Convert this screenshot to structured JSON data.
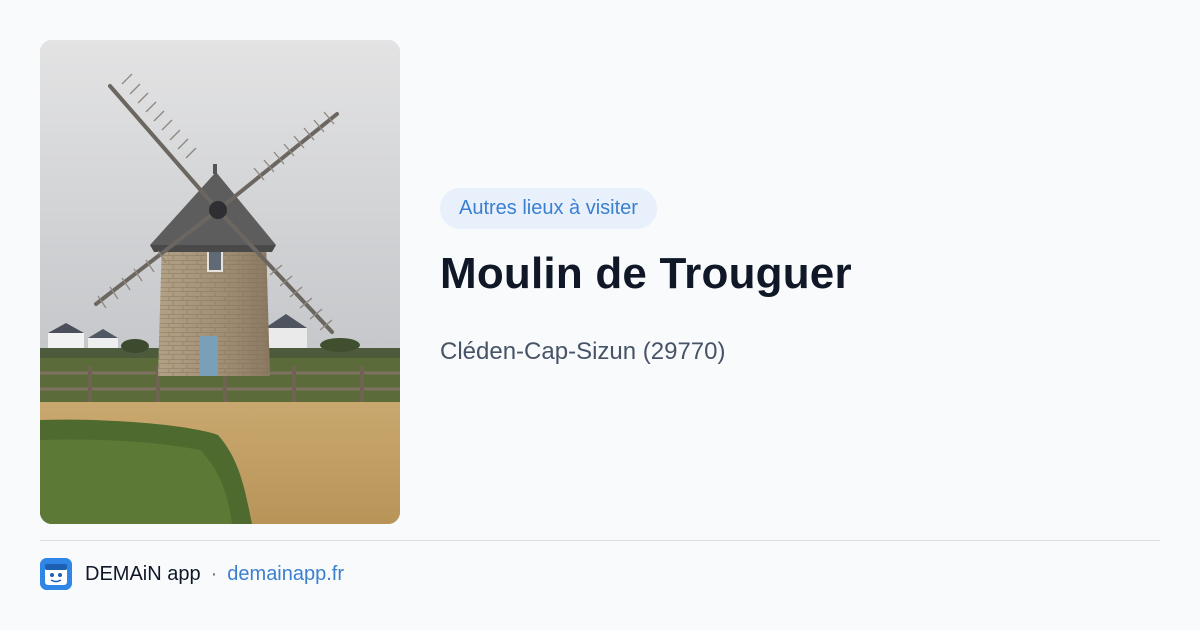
{
  "photo": {
    "subject": "windmill"
  },
  "badge": "Autres lieux à visiter",
  "title": "Moulin de Trouguer",
  "location": "Cléden-Cap-Sizun (29770)",
  "footer": {
    "app_icon": "demain-app-icon",
    "app_name": "DEMAiN app",
    "separator": "·",
    "link": "demainapp.fr"
  },
  "colors": {
    "background": "#f8fafc",
    "accent": "#3b7fcf",
    "badge_bg": "#e8f0fb",
    "title": "#101828",
    "subtitle": "#475467"
  }
}
